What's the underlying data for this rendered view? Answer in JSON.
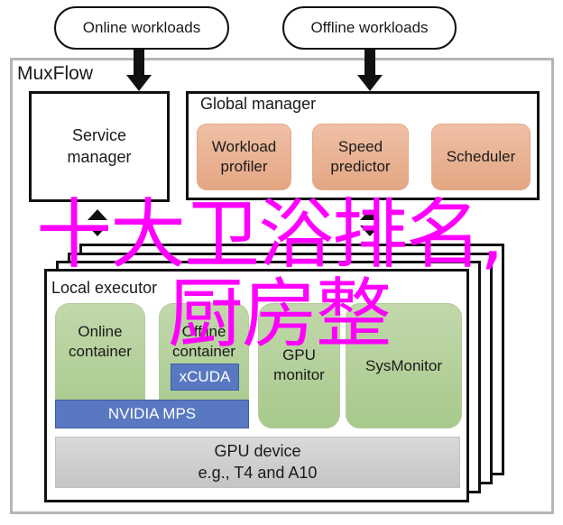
{
  "inputs": {
    "online": "Online workloads",
    "offline": "Offline workloads"
  },
  "system": {
    "title": "MuxFlow",
    "service_manager": "Service\nmanager",
    "global_manager": {
      "title": "Global manager",
      "components": [
        "Workload\nprofiler",
        "Speed\npredictor",
        "Scheduler"
      ]
    },
    "local_executor": {
      "title": "Local executor",
      "online_container": "Online\ncontainer",
      "offline_container": "Offline\ncontainer",
      "xcuda": "xCUDA",
      "nvidia_mps": "NVIDIA MPS",
      "gpu_monitor": "GPU\nmonitor",
      "sysmonitor": "SysMonitor",
      "gpu_device": "GPU device\ne.g., T4 and A10"
    }
  },
  "overlay": {
    "line1": "十大卫浴排名,",
    "line2": "厨房整"
  },
  "colors": {
    "overlay": "#ff00ff",
    "orange": "#e8ad8c",
    "green": "#b3d09a",
    "blue": "#5878c2",
    "gray": "#d0d0d0"
  }
}
